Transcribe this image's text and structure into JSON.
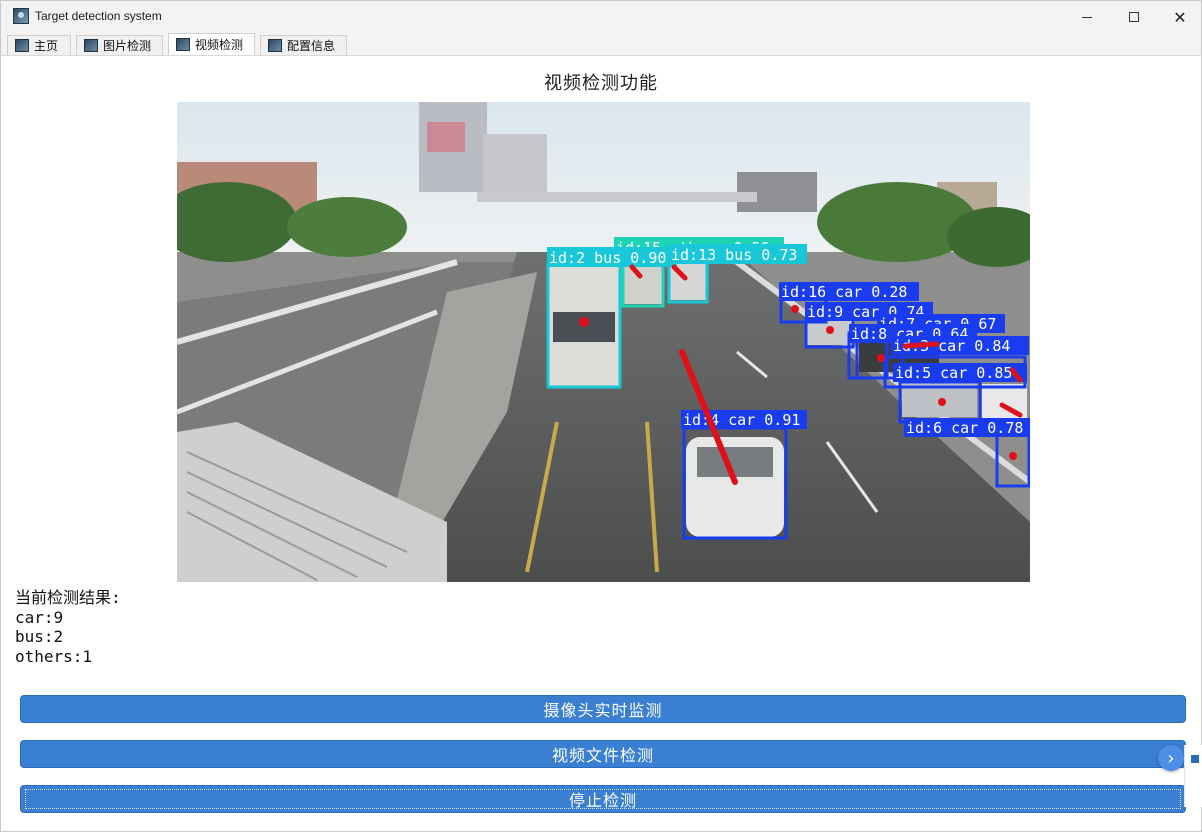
{
  "window": {
    "title": "Target detection system"
  },
  "tabs": [
    {
      "label": "主页",
      "icon": "app-image-icon"
    },
    {
      "label": "图片检测",
      "icon": "app-image-icon"
    },
    {
      "label": "视频检测",
      "icon": "app-image-icon",
      "active": true
    },
    {
      "label": "配置信息",
      "icon": "app-image-icon"
    }
  ],
  "page": {
    "title": "视频检测功能"
  },
  "detections": [
    {
      "label": "id:2 bus 0.90",
      "color": "#19c8d8"
    },
    {
      "label": "id:15 others 0.56",
      "color": "#1fd4b6"
    },
    {
      "label": "id:13 bus 0.73",
      "color": "#19c8d8"
    },
    {
      "label": "id:16 car 0.28",
      "color": "#1a3cf0"
    },
    {
      "label": "id:9 car 0.74",
      "color": "#1a3cf0"
    },
    {
      "label": "id:7 car 0.67",
      "color": "#1a3cf0"
    },
    {
      "label": "id:8 car 0.64",
      "color": "#1a3cf0"
    },
    {
      "label": "id:3 car 0.84",
      "color": "#1a3cf0"
    },
    {
      "label": "id:5 car 0.85",
      "color": "#1a3cf0"
    },
    {
      "label": "id:4 car 0.91",
      "color": "#1a3cf0"
    },
    {
      "label": "id:6 car 0.78",
      "color": "#1a3cf0"
    }
  ],
  "results": {
    "heading": "当前检测结果:",
    "lines": [
      "car:9",
      "bus:2",
      "others:1"
    ]
  },
  "buttons": {
    "camera": "摄像头实时监测",
    "video_file": "视频文件检测",
    "stop": "停止检测"
  },
  "colors": {
    "button_blue": "#3a7fd1",
    "track_red": "#e0101a"
  }
}
